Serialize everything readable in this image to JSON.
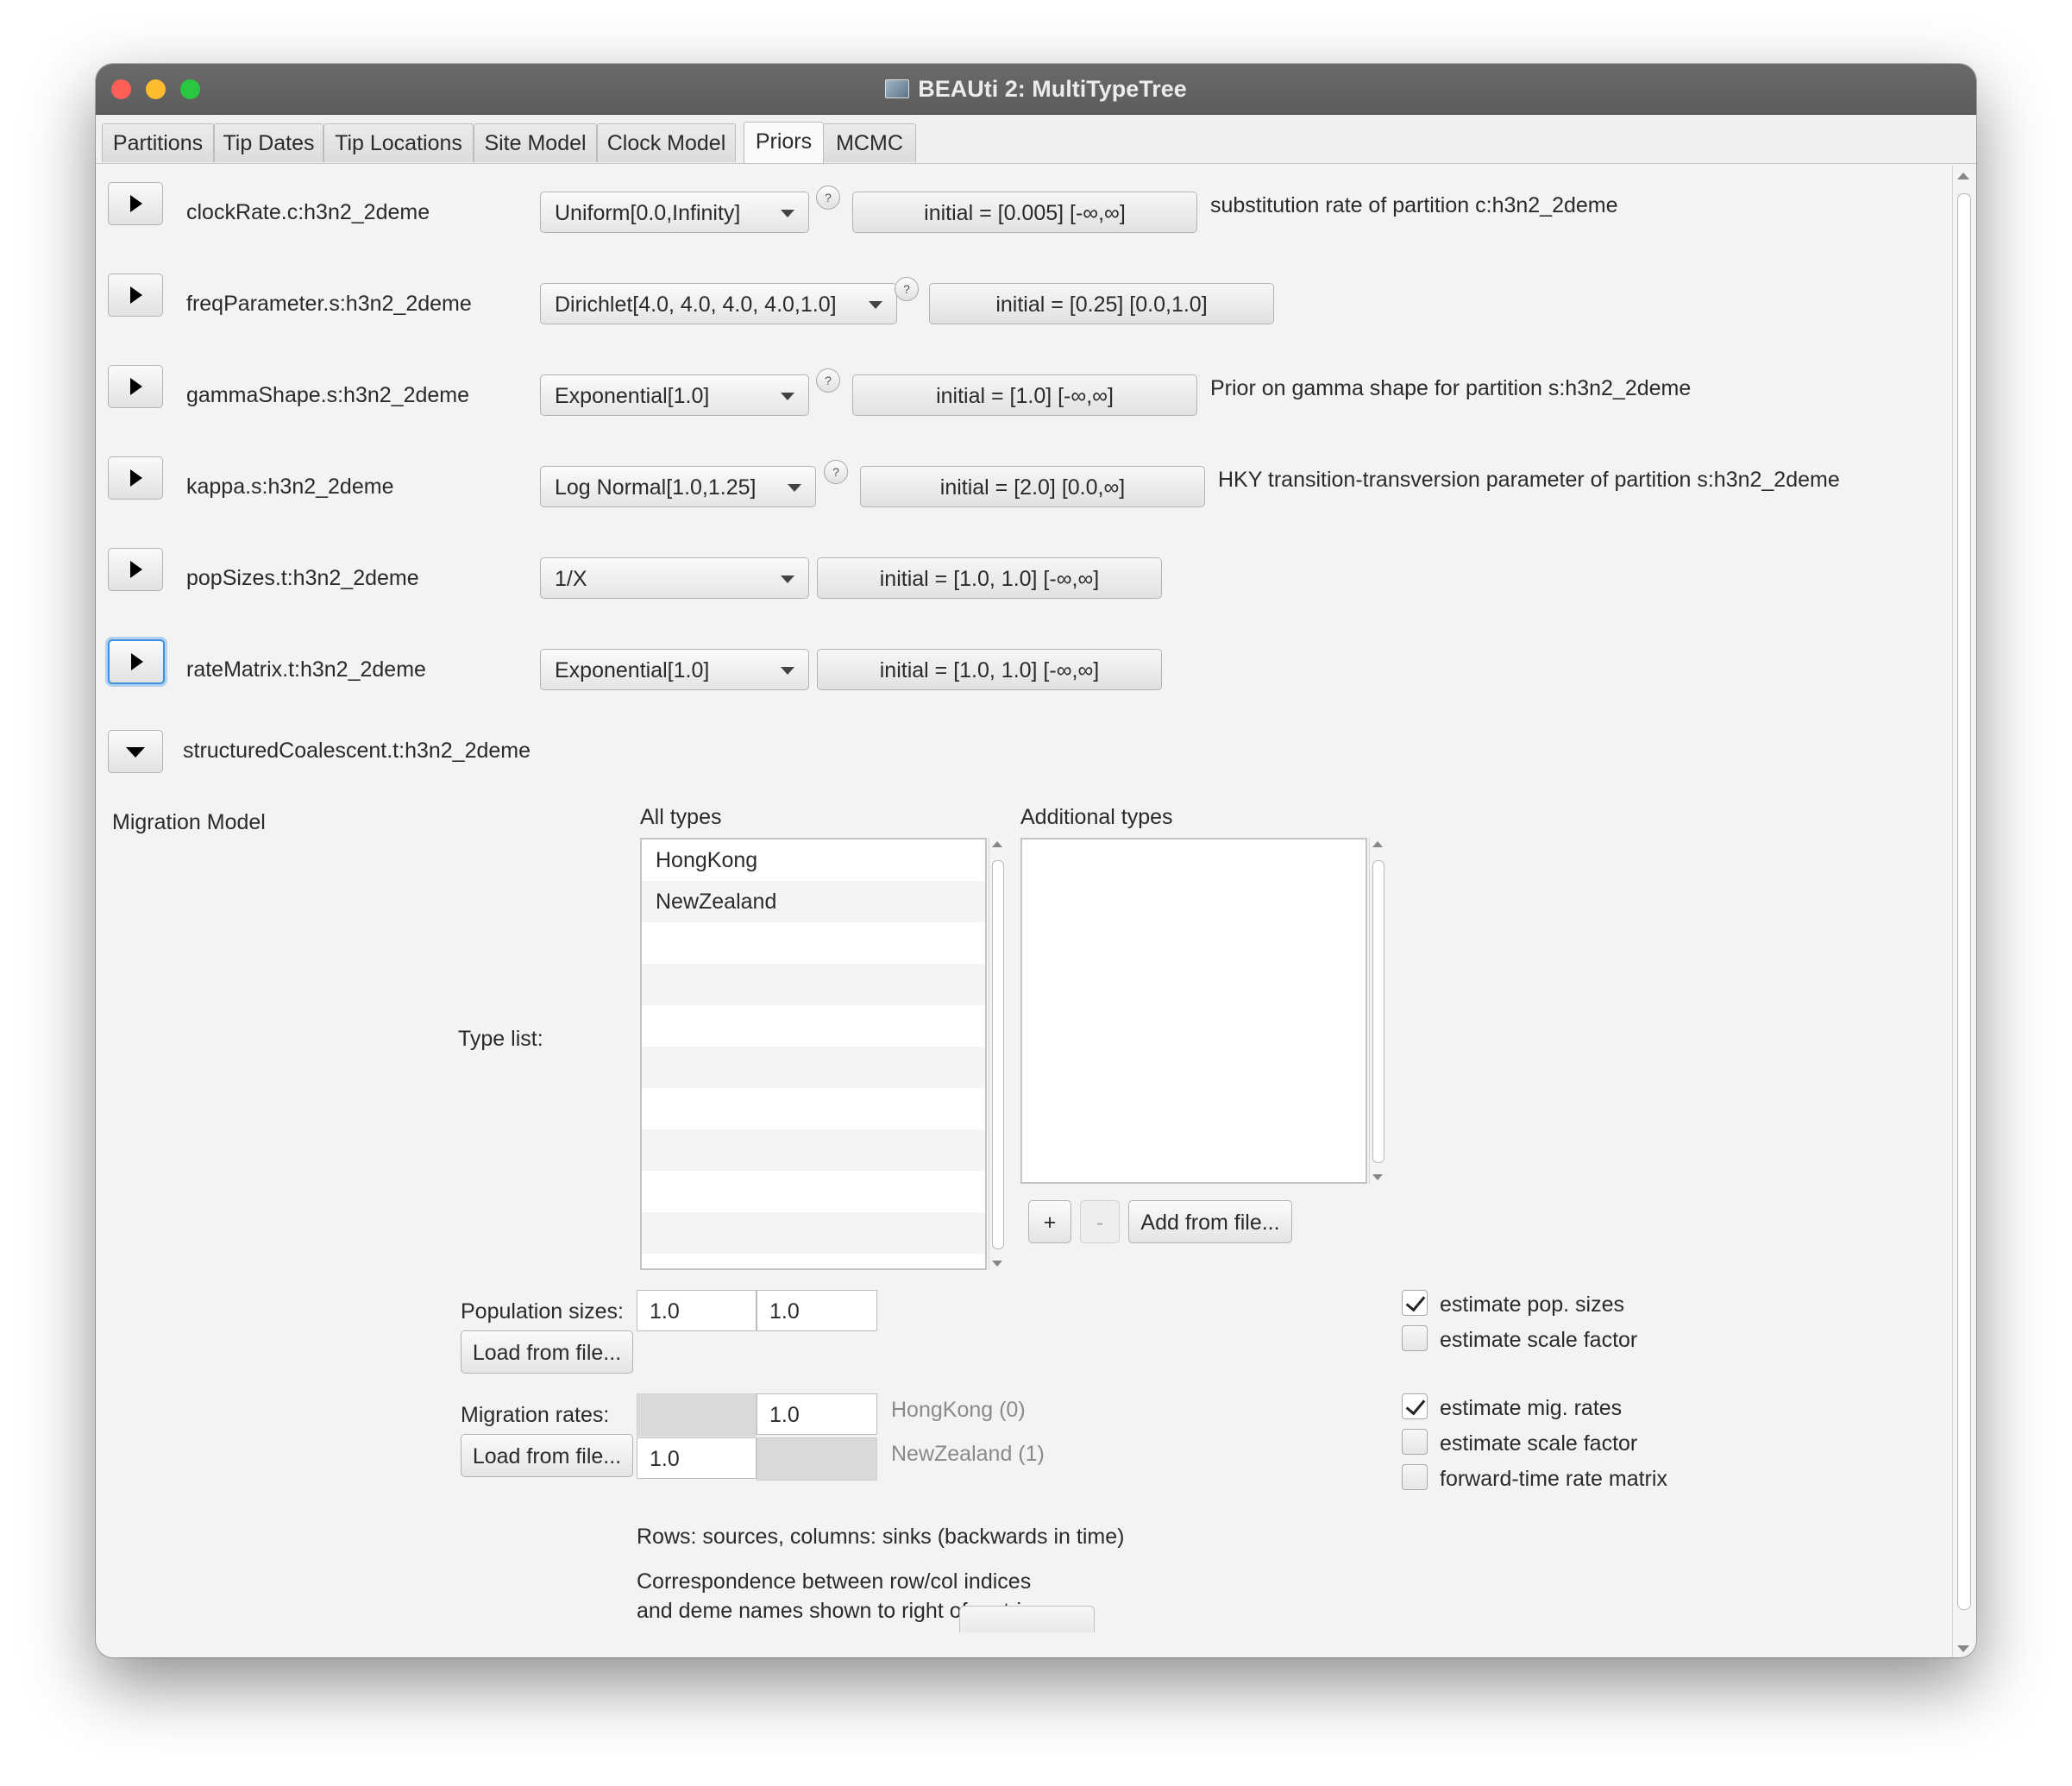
{
  "window": {
    "title": "BEAUti 2: MultiTypeTree"
  },
  "tabs": [
    {
      "label": "Partitions"
    },
    {
      "label": "Tip Dates"
    },
    {
      "label": "Tip Locations"
    },
    {
      "label": "Site Model"
    },
    {
      "label": "Clock Model"
    },
    {
      "label": "Priors",
      "selected": true
    },
    {
      "label": "MCMC"
    }
  ],
  "priors": [
    {
      "name": "clockRate.c:h3n2_2deme",
      "distribution": "Uniform[0.0,Infinity]",
      "initial": "initial = [0.005] [-∞,∞]",
      "description": "substitution rate of partition c:h3n2_2deme"
    },
    {
      "name": "freqParameter.s:h3n2_2deme",
      "distribution": "Dirichlet[4.0, 4.0, 4.0, 4.0,1.0]",
      "initial": "initial = [0.25] [0.0,1.0]",
      "description": ""
    },
    {
      "name": "gammaShape.s:h3n2_2deme",
      "distribution": "Exponential[1.0]",
      "initial": "initial = [1.0] [-∞,∞]",
      "description": "Prior on gamma shape for partition s:h3n2_2deme"
    },
    {
      "name": "kappa.s:h3n2_2deme",
      "distribution": "Log Normal[1.0,1.25]",
      "initial": "initial = [2.0] [0.0,∞]",
      "description": "HKY transition-transversion parameter of partition s:h3n2_2deme"
    },
    {
      "name": "popSizes.t:h3n2_2deme",
      "distribution": "1/X",
      "initial": "initial = [1.0, 1.0] [-∞,∞]",
      "description": ""
    },
    {
      "name": "rateMatrix.t:h3n2_2deme",
      "distribution": "Exponential[1.0]",
      "initial": "initial = [1.0, 1.0] [-∞,∞]",
      "description": ""
    }
  ],
  "structured": {
    "name": "structuredCoalescent.t:h3n2_2deme"
  },
  "migration": {
    "section_label": "Migration Model",
    "type_list_label": "Type list:",
    "all_types_label": "All types",
    "additional_types_label": "Additional types",
    "all_types": [
      "HongKong",
      "NewZealand"
    ],
    "add_button": "+",
    "remove_button": "-",
    "add_from_file_button": "Add from file...",
    "pop_sizes_label": "Population sizes:",
    "pop_sizes": [
      "1.0",
      "1.0"
    ],
    "load_from_file_button": "Load from file...",
    "mig_rates_label": "Migration rates:",
    "mig_rate_01": "1.0",
    "mig_rate_10": "1.0",
    "deme_labels": [
      "HongKong (0)",
      "NewZealand (1)"
    ],
    "rows_note": "Rows: sources, columns: sinks (backwards in time)",
    "corr_note_1": "Correspondence between row/col indices",
    "corr_note_2": "and deme names shown to right of matrix.",
    "checkboxes": [
      {
        "label": "estimate pop. sizes",
        "checked": true
      },
      {
        "label": "estimate scale factor",
        "checked": false
      },
      {
        "label": "estimate mig. rates",
        "checked": true
      },
      {
        "label": "estimate scale factor",
        "checked": false
      },
      {
        "label": "forward-time rate matrix",
        "checked": false
      }
    ]
  }
}
